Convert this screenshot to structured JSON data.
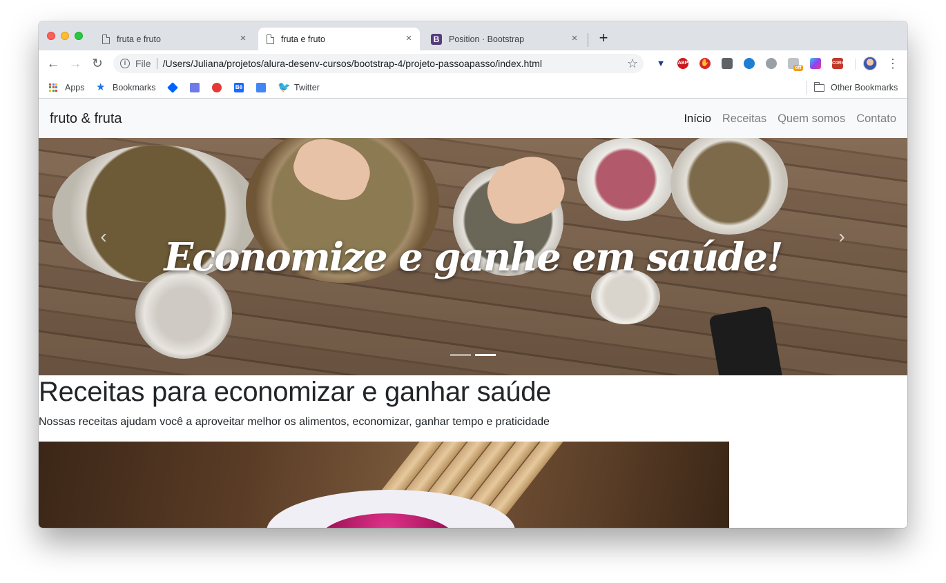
{
  "browser": {
    "tabs": [
      {
        "title": "fruta e fruto",
        "icon": "document-icon",
        "active": false
      },
      {
        "title": "fruta e fruto",
        "icon": "document-icon",
        "active": true
      },
      {
        "title": "Position · Bootstrap",
        "icon": "bootstrap-icon",
        "active": false
      }
    ],
    "new_tab_symbol": "+",
    "close_symbol": "×",
    "omnibox": {
      "scheme_label": "File",
      "url": "/Users/Juliana/projetos/alura-desenv-cursos/bootstrap-4/projeto-passoapasso/index.html"
    },
    "extension_labels": {
      "abp": "ABP",
      "cors": "CORS",
      "off": "off"
    },
    "bookmarks": [
      {
        "label": "Apps",
        "icon": "apps-grid-icon"
      },
      {
        "label": "Bookmarks",
        "icon": "star-icon"
      },
      {
        "label": "",
        "icon": "dropbox-icon"
      },
      {
        "label": "",
        "icon": "mail-icon"
      },
      {
        "label": "",
        "icon": "trend-icon"
      },
      {
        "label": "",
        "icon": "behance-icon"
      },
      {
        "label": "",
        "icon": "docs-icon"
      },
      {
        "label": "Twitter",
        "icon": "twitter-icon"
      }
    ],
    "other_bookmarks": "Other Bookmarks",
    "behance_label": "Bē"
  },
  "site": {
    "brand": "fruto & fruta",
    "nav": [
      {
        "label": "Início",
        "active": true
      },
      {
        "label": "Receitas",
        "active": false
      },
      {
        "label": "Quem somos",
        "active": false
      },
      {
        "label": "Contato",
        "active": false
      }
    ],
    "carousel": {
      "caption": "Economize e ganhe em saúde!",
      "prev_symbol": "‹",
      "next_symbol": "›",
      "slide_count": 2,
      "active_slide": 2
    },
    "section": {
      "title": "Receitas para economizar e ganhar saúde",
      "lead": "Nossas receitas ajudam você a aproveitar melhor os alimentos, economizar, ganhar tempo e praticidade"
    }
  },
  "colors": {
    "tabstrip": "#dee1e6",
    "navbar_bg": "#f8f9fa",
    "bootstrap_purple": "#563d7c",
    "text_dark": "#212529"
  }
}
